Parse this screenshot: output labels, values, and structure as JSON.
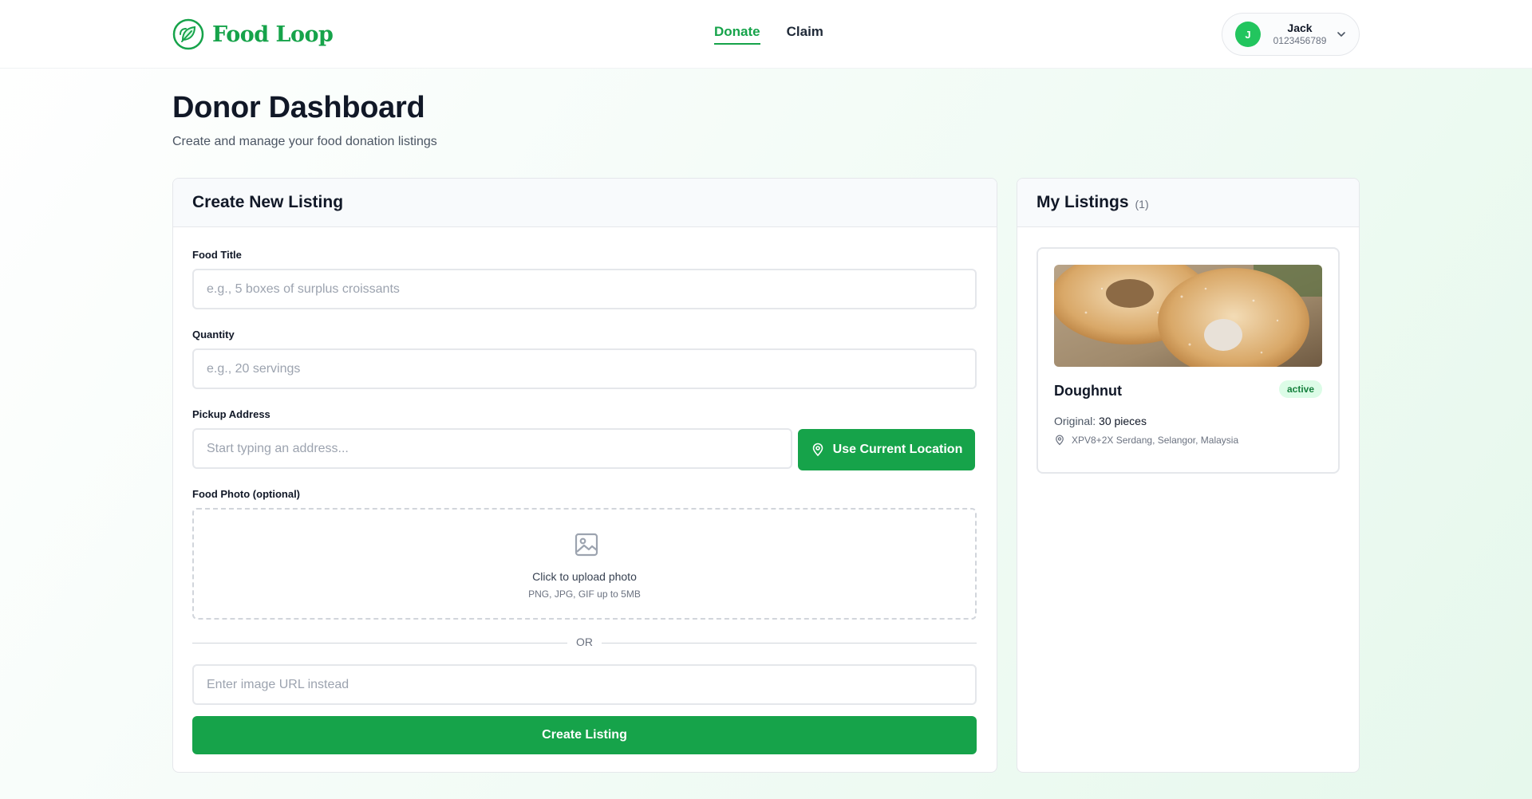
{
  "app": {
    "name": "Food Loop",
    "brand_color": "#16a34a"
  },
  "nav": {
    "items": [
      {
        "label": "Donate",
        "active": true
      },
      {
        "label": "Claim",
        "active": false
      }
    ]
  },
  "user": {
    "initial": "J",
    "name": "Jack",
    "phone": "0123456789"
  },
  "page": {
    "title": "Donor Dashboard",
    "subtitle": "Create and manage your food donation listings"
  },
  "create": {
    "title": "Create New Listing",
    "food_title": {
      "label": "Food Title",
      "placeholder": "e.g., 5 boxes of surplus croissants",
      "value": ""
    },
    "quantity": {
      "label": "Quantity",
      "placeholder": "e.g., 20 servings",
      "value": ""
    },
    "address": {
      "label": "Pickup Address",
      "placeholder": "Start typing an address...",
      "value": ""
    },
    "location_button": "Use Current Location",
    "photo": {
      "label": "Food Photo (optional)",
      "upload_text": "Click to upload photo",
      "upload_hint": "PNG, JPG, GIF up to 5MB"
    },
    "or_text": "OR",
    "image_url": {
      "placeholder": "Enter image URL instead",
      "value": ""
    },
    "submit_label": "Create Listing"
  },
  "listings": {
    "title": "My Listings",
    "count": "(1)",
    "items": [
      {
        "name": "Doughnut",
        "status": "active",
        "original_label": "Original:",
        "original_value": "30 pieces",
        "address": "XPV8+2X Serdang, Selangor, Malaysia",
        "image": "doughnut-photo"
      }
    ]
  }
}
